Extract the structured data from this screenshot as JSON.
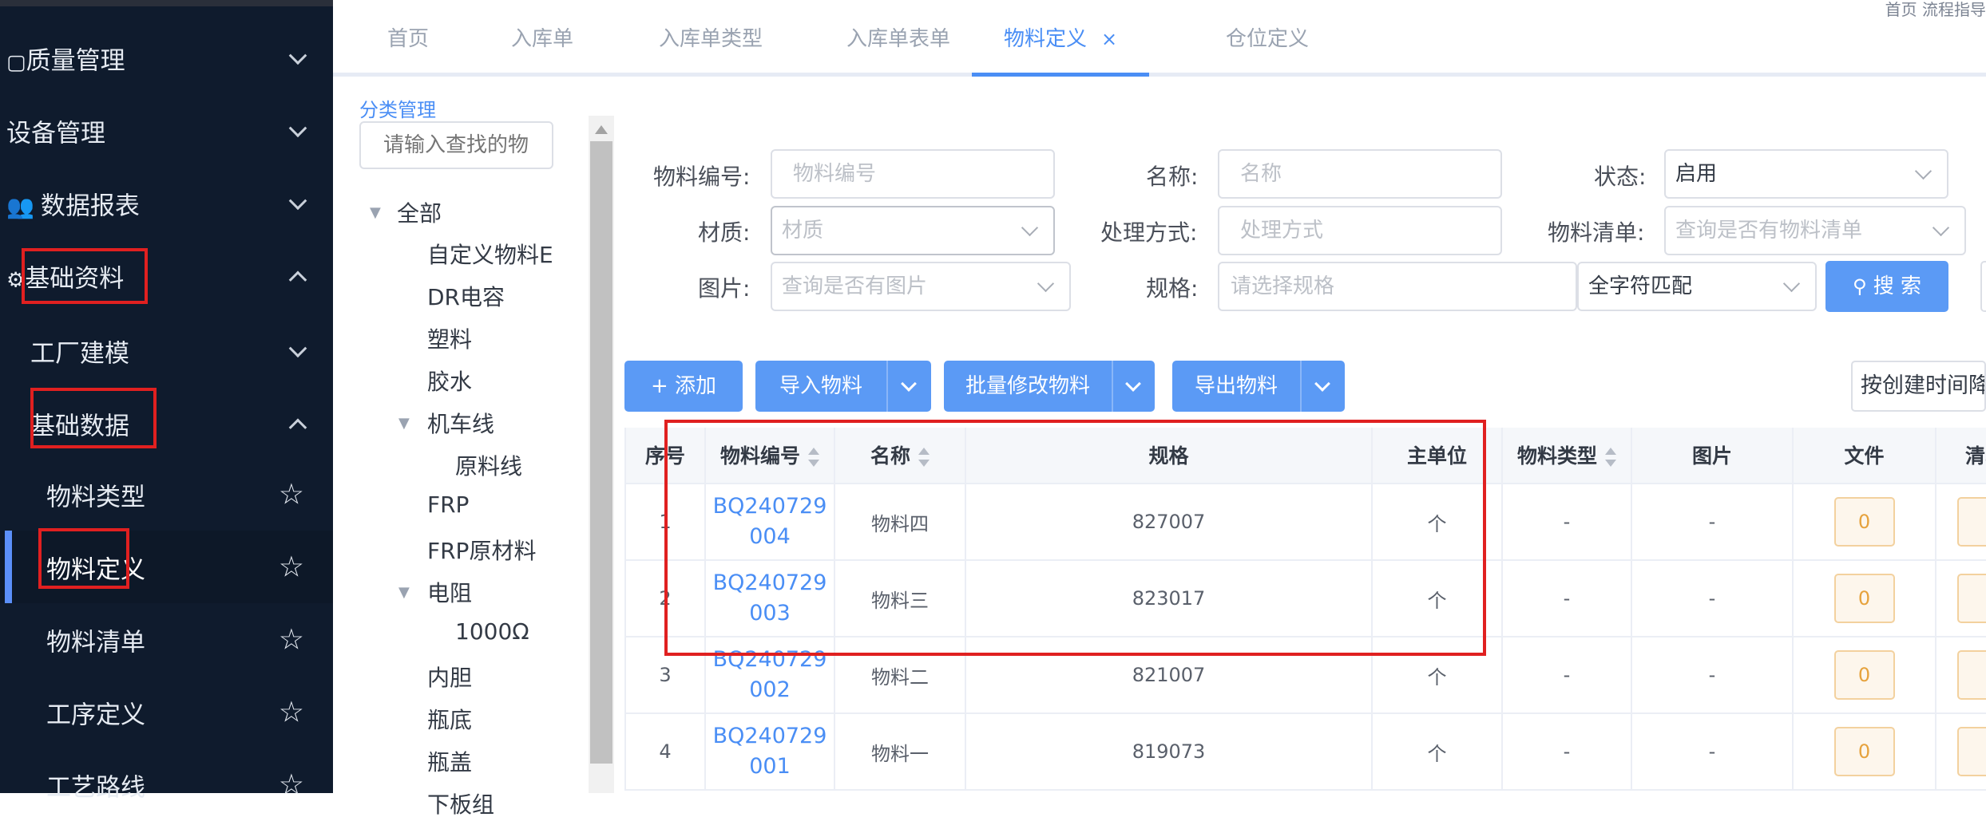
{
  "sidebar": {
    "items": [
      {
        "label": "质量管理",
        "icon": "quality-icon",
        "expanded": false
      },
      {
        "label": "设备管理",
        "expanded": false
      },
      {
        "label": "数据报表",
        "icon": "users-icon",
        "expanded": false
      },
      {
        "label": "基础资料",
        "icon": "gear-icon",
        "expanded": true
      },
      {
        "label": "工厂建模",
        "expanded": false
      },
      {
        "label": "基础数据",
        "expanded": true
      },
      {
        "label": "物料类型",
        "starred": false
      },
      {
        "label": "物料定义",
        "starred": false,
        "active": true
      },
      {
        "label": "物料清单",
        "starred": false
      },
      {
        "label": "工序定义",
        "starred": false
      },
      {
        "label": "工艺路线",
        "starred": false
      }
    ]
  },
  "tabs": [
    {
      "label": "首页"
    },
    {
      "label": "入库单"
    },
    {
      "label": "入库单类型"
    },
    {
      "label": "入库单表单"
    },
    {
      "label": "物料定义",
      "active": true,
      "close": "×"
    },
    {
      "label": "仓位定义"
    }
  ],
  "topright": "首页 流程指导",
  "category": {
    "title": "分类管理",
    "search_placeholder": "请输入查找的物",
    "nodes": [
      {
        "label": "全部"
      },
      {
        "label": "自定义物料E"
      },
      {
        "label": "DR电容"
      },
      {
        "label": "塑料"
      },
      {
        "label": "胶水"
      },
      {
        "label": "机车线"
      },
      {
        "label": "原料线"
      },
      {
        "label": "FRP"
      },
      {
        "label": "FRP原材料"
      },
      {
        "label": "电阻"
      },
      {
        "label": "1000Ω"
      },
      {
        "label": "内胆"
      },
      {
        "label": "瓶底"
      },
      {
        "label": "瓶盖"
      },
      {
        "label": "下板组"
      }
    ]
  },
  "filters": {
    "code_label": "物料编号:",
    "code_placeholder": "物料编号",
    "name_label": "名称:",
    "name_placeholder": "名称",
    "status_label": "状态:",
    "status_value": "启用",
    "material_label": "材质:",
    "material_placeholder": "材质",
    "process_label": "处理方式:",
    "process_placeholder": "处理方式",
    "bom_label": "物料清单:",
    "bom_placeholder": "查询是否有物料清单",
    "image_label": "图片:",
    "image_placeholder": "查询是否有图片",
    "spec_label": "规格:",
    "spec_placeholder": "请选择规格",
    "match_value": "全字符匹配",
    "search_button": "搜 索"
  },
  "toolbar": {
    "add": "+ 添加",
    "import": "导入物料",
    "batch_edit": "批量修改物料",
    "export": "导出物料",
    "sort_select": "按创建时间降"
  },
  "table": {
    "headers": [
      "序号",
      "物料编号",
      "名称",
      "规格",
      "主单位",
      "物料类型",
      "图片",
      "文件",
      "清单"
    ],
    "rows": [
      {
        "index": "1",
        "code": "BQ240729004",
        "name": "物料四",
        "spec": "827007",
        "unit": "个",
        "type": "-",
        "image": "-",
        "file": "0"
      },
      {
        "index": "2",
        "code": "BQ240729003",
        "name": "物料三",
        "spec": "823017",
        "unit": "个",
        "type": "-",
        "image": "-",
        "file": "0"
      },
      {
        "index": "3",
        "code": "BQ240729002",
        "name": "物料二",
        "spec": "821007",
        "unit": "个",
        "type": "-",
        "image": "-",
        "file": "0"
      },
      {
        "index": "4",
        "code": "BQ240729001",
        "name": "物料一",
        "spec": "819073",
        "unit": "个",
        "type": "-",
        "image": "-",
        "file": "0"
      }
    ]
  },
  "colors": {
    "sidebar_bg": "#0f1b2d",
    "accent": "#4a8ef5",
    "annotation_red": "#e02020",
    "file_badge": "#e6a23c"
  }
}
